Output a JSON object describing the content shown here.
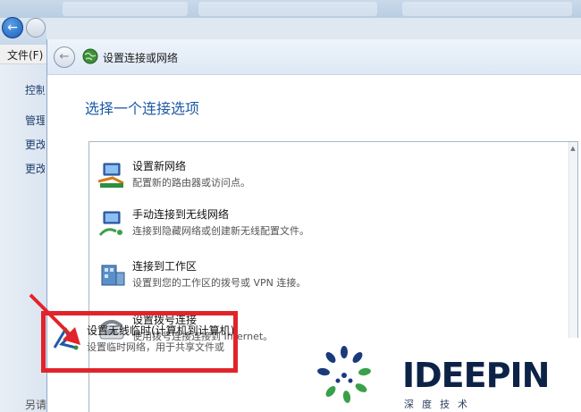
{
  "background": {
    "menu_label": "文件(F)",
    "sidebar_items": [
      "控制",
      "管理",
      "更改",
      "更改"
    ],
    "bottom_label": "另请"
  },
  "dialog": {
    "title": "设置连接或网络",
    "heading": "选择一个连接选项",
    "options": [
      {
        "title": "设置新网络",
        "desc": "配置新的路由器或访问点。",
        "icon": "new-network-icon"
      },
      {
        "title": "手动连接到无线网络",
        "desc": "连接到隐藏网络或创建新无线配置文件。",
        "icon": "wireless-manual-icon"
      },
      {
        "title": "连接到工作区",
        "desc": "设置到您的工作区的拨号或 VPN 连接。",
        "icon": "workplace-icon"
      },
      {
        "title": "设置拨号连接",
        "desc": "使用拨号连接连接到 Internet。",
        "icon": "dialup-phone-icon"
      },
      {
        "title": "设置无线临时(计算机到计算机)网络",
        "desc": "设置临时网络，用于共享文件或",
        "icon": "adhoc-network-icon"
      }
    ]
  },
  "watermark": {
    "brand": "IDEEPIN",
    "sub": "深度技术"
  },
  "colors": {
    "highlight": "#e0242a",
    "heading": "#1e5aa6"
  }
}
